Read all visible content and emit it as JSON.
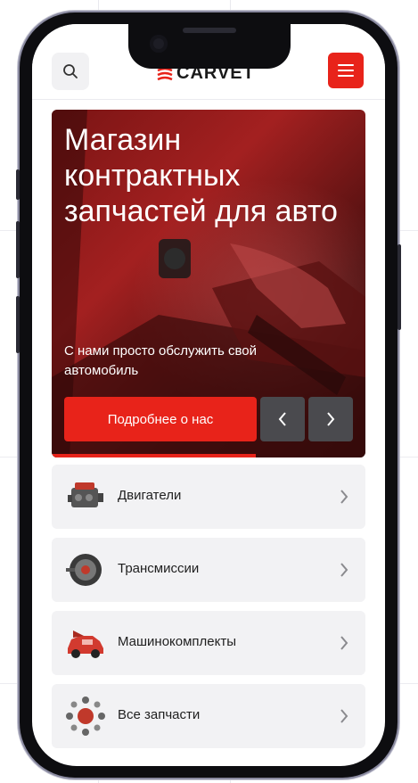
{
  "brand": {
    "logo_text": "CARVET",
    "accent_color": "#e8231a"
  },
  "header": {
    "search_icon": "search-icon",
    "menu_icon": "hamburger-menu-icon"
  },
  "hero": {
    "title": "Магазин контрактных запчастей для авто",
    "subtitle": "С нами просто обслужить свой автомобиль",
    "cta_label": "Подробнее о нас",
    "prev_icon": "chevron-left-icon",
    "next_icon": "chevron-right-icon",
    "slide_progress": 0.65
  },
  "categories": [
    {
      "label": "Двигатели",
      "icon": "engine-icon"
    },
    {
      "label": "Трансмиссии",
      "icon": "transmission-icon"
    },
    {
      "label": "Машинокомплекты",
      "icon": "car-kit-icon"
    },
    {
      "label": "Все запчасти",
      "icon": "all-parts-icon"
    }
  ]
}
